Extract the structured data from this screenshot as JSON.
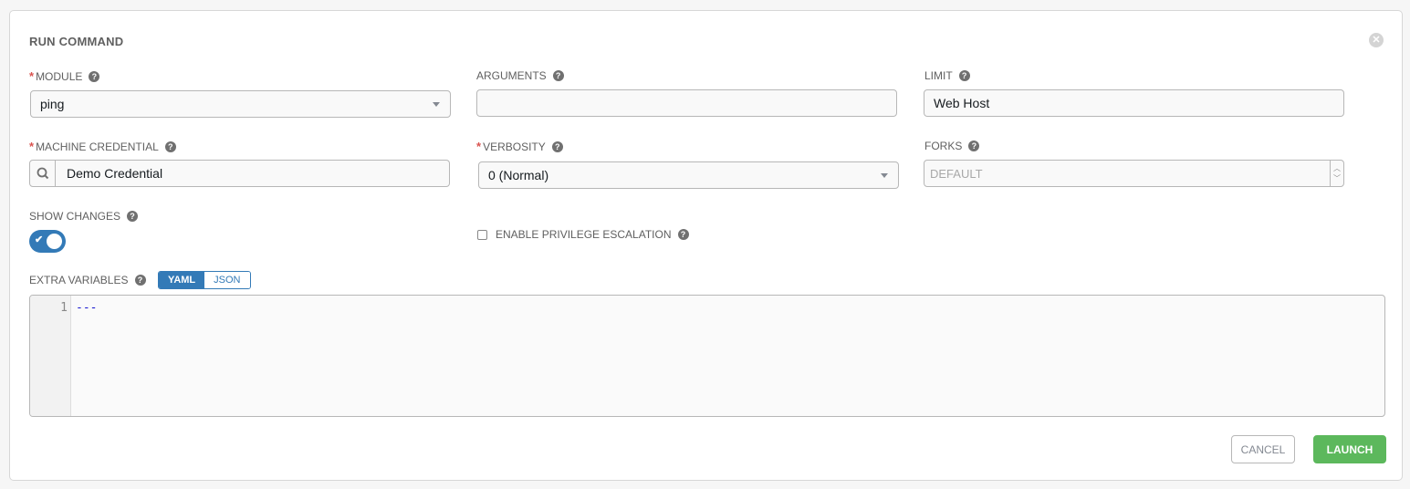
{
  "dialog": {
    "title": "RUN COMMAND",
    "close_icon": "close-circle-icon"
  },
  "fields": {
    "module": {
      "label": "MODULE",
      "required": true,
      "value": "ping"
    },
    "arguments": {
      "label": "ARGUMENTS",
      "required": false,
      "value": ""
    },
    "limit": {
      "label": "LIMIT",
      "required": false,
      "value": "Web Host"
    },
    "machine_credential": {
      "label": "MACHINE CREDENTIAL",
      "required": true,
      "value": "Demo Credential"
    },
    "verbosity": {
      "label": "VERBOSITY",
      "required": true,
      "value": "0 (Normal)"
    },
    "forks": {
      "label": "FORKS",
      "required": false,
      "value": "",
      "placeholder": "DEFAULT"
    },
    "show_changes": {
      "label": "SHOW CHANGES",
      "on": true
    },
    "privilege_escalation": {
      "label": "ENABLE PRIVILEGE ESCALATION",
      "checked": false
    },
    "extra_variables": {
      "label": "EXTRA VARIABLES",
      "modes": [
        "YAML",
        "JSON"
      ],
      "active_mode": "YAML",
      "lines": [
        {
          "number": "1",
          "text": "---"
        }
      ]
    }
  },
  "required_marker": "*",
  "help_glyph": "?",
  "buttons": {
    "cancel": "CANCEL",
    "launch": "LAUNCH"
  },
  "colors": {
    "primary": "#337ab7",
    "success": "#5cb85c",
    "required": "#d9534f"
  }
}
